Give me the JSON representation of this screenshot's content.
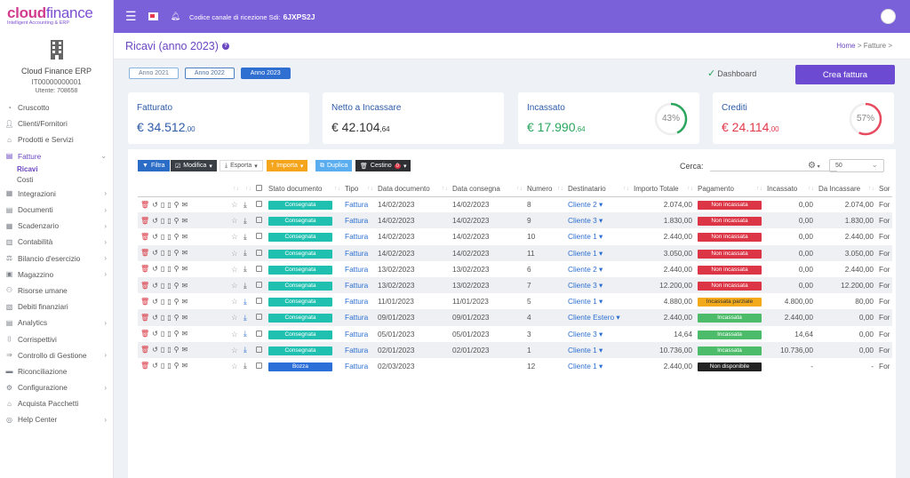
{
  "brand": {
    "name_a": "cloud",
    "name_b": "finance",
    "tagline": "Intelligent Accounting & ERP"
  },
  "company": {
    "name": "Cloud Finance ERP",
    "code": "IT00000000001",
    "user": "Utente: 708658"
  },
  "nav": [
    {
      "label": "Cruscotto",
      "icon": "dashboard-icon",
      "chev": ""
    },
    {
      "label": "Clienti/Fornitori",
      "icon": "person-icon",
      "chev": ""
    },
    {
      "label": "Prodotti e Servizi",
      "icon": "basket-icon",
      "chev": ""
    },
    {
      "label": "Fatture",
      "icon": "document-icon",
      "chev": "⌄",
      "active": true
    },
    {
      "label": "Integrazioni",
      "icon": "integration-icon",
      "chev": "›"
    },
    {
      "label": "Documenti",
      "icon": "documents-icon",
      "chev": "›"
    },
    {
      "label": "Scadenzario",
      "icon": "calendar-icon",
      "chev": "›"
    },
    {
      "label": "Contabilità",
      "icon": "ledger-icon",
      "chev": "›"
    },
    {
      "label": "Bilancio d'esercizio",
      "icon": "balance-icon",
      "chev": "›"
    },
    {
      "label": "Magazzino",
      "icon": "warehouse-icon",
      "chev": "›"
    },
    {
      "label": "Risorse umane",
      "icon": "people-icon",
      "chev": ""
    },
    {
      "label": "Debiti finanziari",
      "icon": "debt-icon",
      "chev": ""
    },
    {
      "label": "Analytics",
      "icon": "analytics-icon",
      "chev": "›"
    },
    {
      "label": "Corrispettivi",
      "icon": "receipt-icon",
      "chev": ""
    },
    {
      "label": "Controllo di Gestione",
      "icon": "arrow-icon",
      "chev": "›"
    },
    {
      "label": "Riconciliazione",
      "icon": "reconcile-icon",
      "chev": ""
    },
    {
      "label": "Configurazione",
      "icon": "gear-icon",
      "chev": "›"
    },
    {
      "label": "Acquista Pacchetti",
      "icon": "cart-icon",
      "chev": ""
    },
    {
      "label": "Help Center",
      "icon": "help-icon",
      "chev": "›"
    }
  ],
  "nav_sub": {
    "ricavi": "Ricavi",
    "costi": "Costi"
  },
  "topbar": {
    "sdi_label": "Codice canale di ricezione Sdi:",
    "sdi_code": "6JXPS2J"
  },
  "header": {
    "title": "Ricavi (anno 2023)",
    "help": "?",
    "crumb_home": "Home",
    "crumb_sep": ">",
    "crumb_page": "Fatture",
    "crumb_end": ">"
  },
  "years": [
    "Anno 2021",
    "Anno 2022",
    "Anno 2023"
  ],
  "dashboard": "Dashboard",
  "new_invoice": "Crea fattura",
  "cards": [
    {
      "label": "Fatturato",
      "value": "€ 34.512",
      "cents": ",00",
      "color": "#2d5ba8"
    },
    {
      "label": "Netto a Incassare",
      "value": "€ 42.104",
      "cents": ",64",
      "color": "#333"
    },
    {
      "label": "Incassato",
      "value": "€ 17.990",
      "cents": ",64",
      "color": "#2aa55d",
      "pct": "43%",
      "pct_num": 43,
      "ring": "#2aa55d"
    },
    {
      "label": "Crediti",
      "value": "€ 24.114",
      "cents": ",00",
      "color": "#e03a4a",
      "pct": "57%",
      "pct_num": 57,
      "ring": "#e84a5f"
    }
  ],
  "toolbar": {
    "filtra": "Filtra",
    "modifica": "Modifica",
    "esporta": "Esporta",
    "importa": "Importa",
    "duplica": "Duplica",
    "cestino": "Cestino",
    "cestino_count": "0",
    "search_label": "Cerca:",
    "page_size": "50"
  },
  "columns": [
    "Stato documento",
    "Tipo",
    "Data documento",
    "Data consegna",
    "Numero",
    "Destinatario",
    "Importo Totale",
    "Pagamento",
    "Incassato",
    "Da Incassare",
    "Sor"
  ],
  "rows": [
    {
      "stato": "Consegnata",
      "tipo": "Fattura",
      "data": "14/02/2023",
      "consegna": "14/02/2023",
      "numero": "8",
      "dest": "Cliente 2",
      "totale": "2.074,00",
      "pag": "Non incassata",
      "pc": "p-red",
      "inc": "0,00",
      "da": "2.074,00",
      "sor": "For",
      "dl": ""
    },
    {
      "stato": "Consegnata",
      "tipo": "Fattura",
      "data": "14/02/2023",
      "consegna": "14/02/2023",
      "numero": "9",
      "dest": "Cliente 3",
      "totale": "1.830,00",
      "pag": "Non incassata",
      "pc": "p-red",
      "inc": "0,00",
      "da": "1.830,00",
      "sor": "For",
      "dl": ""
    },
    {
      "stato": "Consegnata",
      "tipo": "Fattura",
      "data": "14/02/2023",
      "consegna": "14/02/2023",
      "numero": "10",
      "dest": "Cliente 1",
      "totale": "2.440,00",
      "pag": "Non incassata",
      "pc": "p-red",
      "inc": "0,00",
      "da": "2.440,00",
      "sor": "For",
      "dl": ""
    },
    {
      "stato": "Consegnata",
      "tipo": "Fattura",
      "data": "14/02/2023",
      "consegna": "14/02/2023",
      "numero": "11",
      "dest": "Cliente 1",
      "totale": "3.050,00",
      "pag": "Non incassata",
      "pc": "p-red",
      "inc": "0,00",
      "da": "3.050,00",
      "sor": "For",
      "dl": ""
    },
    {
      "stato": "Consegnata",
      "tipo": "Fattura",
      "data": "13/02/2023",
      "consegna": "13/02/2023",
      "numero": "6",
      "dest": "Cliente 2",
      "totale": "2.440,00",
      "pag": "Non incassata",
      "pc": "p-red",
      "inc": "0,00",
      "da": "2.440,00",
      "sor": "For",
      "dl": ""
    },
    {
      "stato": "Consegnata",
      "tipo": "Fattura",
      "data": "13/02/2023",
      "consegna": "13/02/2023",
      "numero": "7",
      "dest": "Cliente 3",
      "totale": "12.200,00",
      "pag": "Non incassata",
      "pc": "p-red",
      "inc": "0,00",
      "da": "12.200,00",
      "sor": "For",
      "dl": ""
    },
    {
      "stato": "Consegnata",
      "tipo": "Fattura",
      "data": "11/01/2023",
      "consegna": "11/01/2023",
      "numero": "5",
      "dest": "Cliente 1",
      "totale": "4.880,00",
      "pag": "Incassata parziale",
      "pc": "p-yel",
      "inc": "4.800,00",
      "da": "80,00",
      "sor": "For",
      "dl": "blue"
    },
    {
      "stato": "Consegnata",
      "tipo": "Fattura",
      "data": "09/01/2023",
      "consegna": "09/01/2023",
      "numero": "4",
      "dest": "Cliente Estero",
      "totale": "2.440,00",
      "pag": "Incassata",
      "pc": "p-grn",
      "inc": "2.440,00",
      "da": "0,00",
      "sor": "For",
      "dl": "blue"
    },
    {
      "stato": "Consegnata",
      "tipo": "Fattura",
      "data": "05/01/2023",
      "consegna": "05/01/2023",
      "numero": "3",
      "dest": "Cliente 3",
      "totale": "14,64",
      "pag": "Incassata",
      "pc": "p-grn",
      "inc": "14,64",
      "da": "0,00",
      "sor": "For",
      "dl": "blue"
    },
    {
      "stato": "Consegnata",
      "tipo": "Fattura",
      "data": "02/01/2023",
      "consegna": "02/01/2023",
      "numero": "1",
      "dest": "Cliente 1",
      "totale": "10.736,00",
      "pag": "Incassata",
      "pc": "p-grn",
      "inc": "10.736,00",
      "da": "0,00",
      "sor": "For",
      "dl": "blue"
    },
    {
      "stato": "Bozza",
      "tipo": "Fattura",
      "data": "02/03/2023",
      "consegna": "",
      "numero": "12",
      "dest": "Cliente 1",
      "totale": "2.440,00",
      "pag": "Non disponibile",
      "pc": "p-blk",
      "inc": "-",
      "da": "-",
      "sor": "For",
      "dl": "",
      "bozza": true
    }
  ]
}
